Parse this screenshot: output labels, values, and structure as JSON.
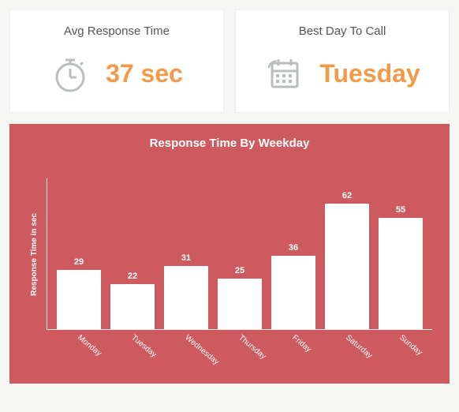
{
  "cards": {
    "avg": {
      "title": "Avg Response Time",
      "value": "37 sec",
      "icon": "stopwatch-icon"
    },
    "best": {
      "title": "Best Day To Call",
      "value": "Tuesday",
      "icon": "calendar-icon"
    }
  },
  "colors": {
    "accent": "#f2994a",
    "panel": "#cc5a5e",
    "bar": "#ffffff"
  },
  "chart_data": {
    "type": "bar",
    "title": "Response Time By Weekday",
    "ylabel": "Response Time in sec",
    "xlabel": "",
    "categories": [
      "Monday",
      "Tuesday",
      "Wednesday",
      "Thursday",
      "Friday",
      "Saturday",
      "Sunday"
    ],
    "values": [
      29,
      22,
      31,
      25,
      36,
      62,
      55
    ],
    "ylim": [
      0,
      70
    ]
  }
}
